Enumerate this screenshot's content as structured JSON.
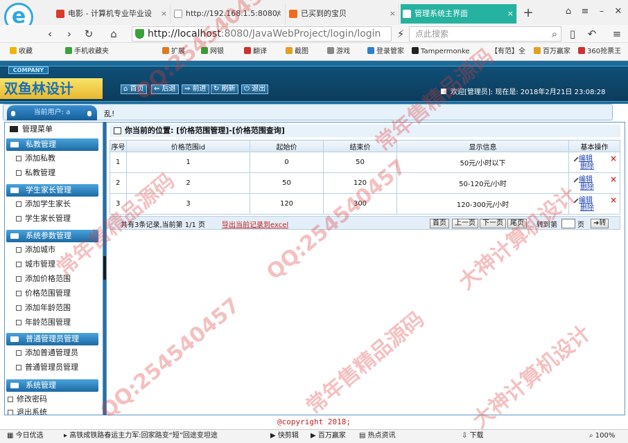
{
  "browser": {
    "tabs": [
      {
        "label": "电影 - 计算机专业毕业设",
        "close": "×"
      },
      {
        "label": "http://192.168.1.5:8080/",
        "close": "×"
      },
      {
        "label": "已买到的宝贝",
        "close": "×"
      },
      {
        "label": "管理系统主界面",
        "close": "×"
      }
    ],
    "new_tab": "+",
    "url_host": "http://localhost",
    "url_path": ":8080/JavaWebProject/login/login",
    "search_placeholder": "点此搜索",
    "bookmarks": [
      "收藏",
      "手机收藏夹",
      "扩展",
      "网银",
      "翻译",
      "截图",
      "游戏",
      "登录管家",
      "Tampermonke",
      "【有范】全",
      "百万赢家",
      "360抢票王"
    ]
  },
  "app": {
    "company_label": "COMPANY",
    "brand": "双鱼林设计",
    "toolbar": [
      "首页",
      "后退",
      "前进",
      "刷新",
      "退出"
    ],
    "welcome": "欢迎[管理员]:  现在是: 2018年2月21日 23:08:28",
    "current_user_label": "当前用户: a",
    "notice_text": "乱!"
  },
  "sidebar": {
    "title": "管理菜单",
    "groups": [
      {
        "label": "私教管理",
        "items": [
          "添加私教",
          "私教管理"
        ]
      },
      {
        "label": "学生家长管理",
        "items": [
          "添加学生家长",
          "学生家长管理"
        ]
      },
      {
        "label": "系统参数管理",
        "items": [
          "添加城市",
          "城市管理",
          "添加价格范围",
          "价格范围管理",
          "添加年龄范围",
          "年龄范围管理"
        ]
      },
      {
        "label": "普通管理员管理",
        "items": [
          "添加普通管理员",
          "普通管理员管理"
        ]
      },
      {
        "label": "系统管理",
        "items": [
          "修改密码",
          "退出系统"
        ]
      }
    ]
  },
  "main": {
    "breadcrumb": "你当前的位置: [价格范围管理]-[价格范围查询]",
    "columns": [
      "序号",
      "价格范围id",
      "起始价",
      "结束价",
      "显示信息",
      "基本操作"
    ],
    "rows": [
      {
        "no": "1",
        "id": "1",
        "start": "0",
        "end": "50",
        "info": "50元/小时以下"
      },
      {
        "no": "2",
        "id": "2",
        "start": "50",
        "end": "120",
        "info": "50-120元/小时"
      },
      {
        "no": "3",
        "id": "3",
        "start": "120",
        "end": "300",
        "info": "120-300元/小时"
      }
    ],
    "edit_label": "编辑",
    "delete_label": "删除",
    "delete_icon": "×",
    "pager": {
      "summary": "共有3条记录,当前第 1/1 页",
      "export": "导出当前记录到excel",
      "first": "首页",
      "prev": "上一页",
      "next": "下一页",
      "last": "尾页",
      "goto_label": "转到第",
      "page_unit": "页",
      "go": "转"
    }
  },
  "footer": {
    "copyright": "@copyright 2018;",
    "status_left": "今日优选",
    "status_news": "高铁成铁路春运主力军:回家路变“短”回途变坦途",
    "status_items": [
      "快剪辑",
      "百万赢家",
      "热点资讯",
      "下载",
      "100%"
    ]
  },
  "watermarks": [
    "大神计算机设计",
    "QQ:254540457",
    "常年售精品源码"
  ],
  "colors": {
    "accent": "#1b6a9a",
    "tab_active": "#26b2a0",
    "link": "#1a3fb0",
    "export": "#c0221f"
  }
}
